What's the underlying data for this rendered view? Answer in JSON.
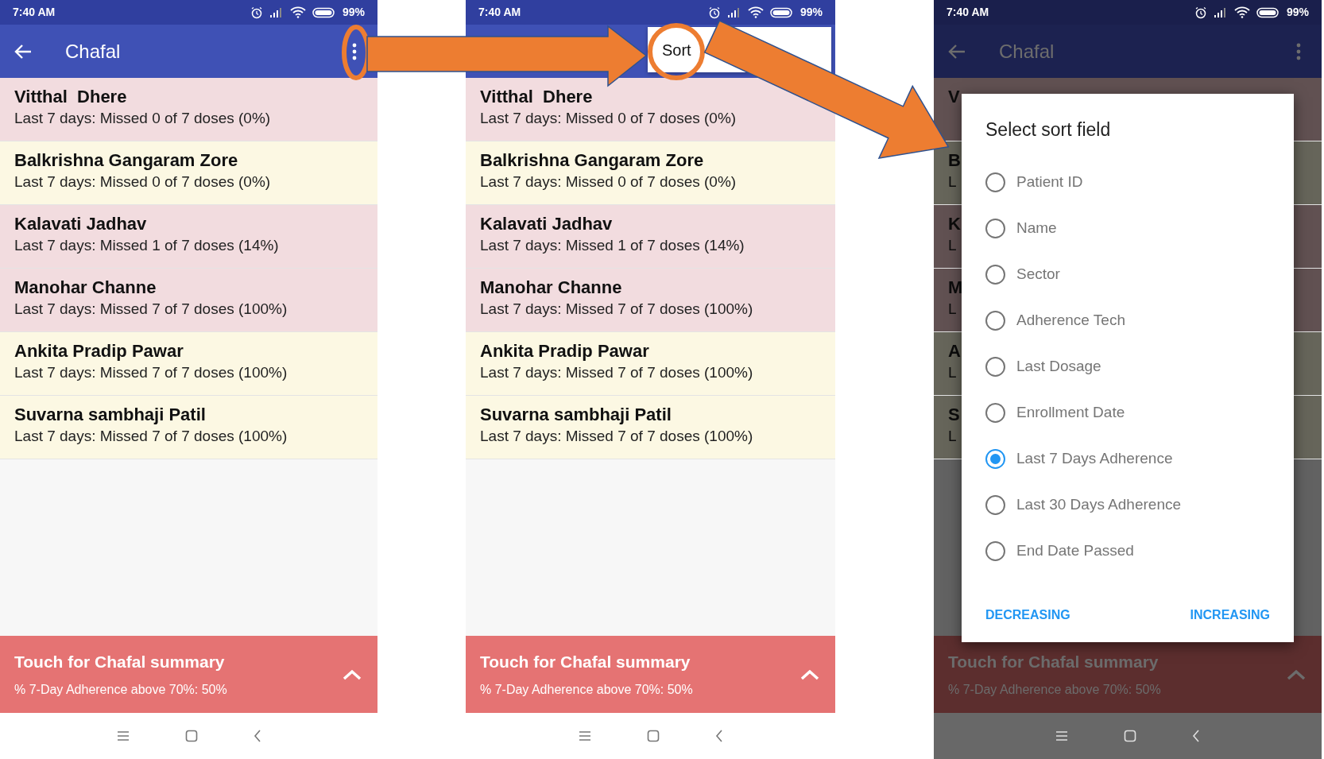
{
  "screens": [
    {
      "kind": "list",
      "dimmed": false,
      "status_bar": {
        "time": "7:40 AM",
        "battery": "99%"
      },
      "app_bar": {
        "title": "Chafal"
      },
      "patients": [
        {
          "name": "Vitthal  Dhere",
          "detail": "Last 7 days: Missed 0 of 7 doses (0%)",
          "color": "#f2dcdf"
        },
        {
          "name": "Balkrishna Gangaram Zore",
          "detail": "Last 7 days: Missed 0 of 7 doses (0%)",
          "color": "#fcf8e3"
        },
        {
          "name": "Kalavati Jadhav",
          "detail": "Last 7 days: Missed 1 of 7 doses (14%)",
          "color": "#f2dcdf"
        },
        {
          "name": "Manohar Channe",
          "detail": "Last 7 days: Missed 7 of 7 doses (100%)",
          "color": "#f2dcdf"
        },
        {
          "name": "Ankita Pradip Pawar",
          "detail": "Last 7 days: Missed 7 of 7 doses (100%)",
          "color": "#fcf8e3"
        },
        {
          "name": "Suvarna sambhaji Patil",
          "detail": "Last 7 days: Missed 7 of 7 doses (100%)",
          "color": "#fcf8e3"
        }
      ],
      "summary": {
        "title": "Touch for Chafal summary",
        "detail": "% 7-Day Adherence above 70%: 50%"
      }
    },
    {
      "kind": "menu",
      "dimmed": false,
      "status_bar": {
        "time": "7:40 AM",
        "battery": "99%"
      },
      "menu": {
        "items": [
          "Sort"
        ]
      },
      "patients": [
        {
          "name": "Vitthal  Dhere",
          "detail": "Last 7 days: Missed 0 of 7 doses (0%)",
          "color": "#f2dcdf"
        },
        {
          "name": "Balkrishna Gangaram Zore",
          "detail": "Last 7 days: Missed 0 of 7 doses (0%)",
          "color": "#fcf8e3"
        },
        {
          "name": "Kalavati Jadhav",
          "detail": "Last 7 days: Missed 1 of 7 doses (14%)",
          "color": "#f2dcdf"
        },
        {
          "name": "Manohar Channe",
          "detail": "Last 7 days: Missed 7 of 7 doses (100%)",
          "color": "#f2dcdf"
        },
        {
          "name": "Ankita Pradip Pawar",
          "detail": "Last 7 days: Missed 7 of 7 doses (100%)",
          "color": "#fcf8e3"
        },
        {
          "name": "Suvarna sambhaji Patil",
          "detail": "Last 7 days: Missed 7 of 7 doses (100%)",
          "color": "#fcf8e3"
        }
      ],
      "summary": {
        "title": "Touch for Chafal summary",
        "detail": "% 7-Day Adherence above 70%: 50%"
      }
    },
    {
      "kind": "dialog",
      "dimmed": true,
      "status_bar": {
        "time": "7:40 AM",
        "battery": "99%"
      },
      "app_bar": {
        "title": "Chafal"
      },
      "patients": [
        {
          "name": "V",
          "color": "#615152"
        },
        {
          "name": "B",
          "detail": "L",
          "color": "#66655a"
        },
        {
          "name": "K",
          "detail": "L",
          "color": "#615152"
        },
        {
          "name": "M",
          "detail": "L",
          "color": "#615152"
        },
        {
          "name": "A",
          "detail": "L",
          "color": "#66655a"
        },
        {
          "name": "S",
          "detail": "L",
          "color": "#66655a"
        }
      ],
      "summary": {
        "title": "Touch for Chafal summary",
        "detail": "% 7-Day Adherence above 70%: 50%"
      },
      "dialog": {
        "title": "Select sort field",
        "options": [
          {
            "label": "Patient ID",
            "selected": false
          },
          {
            "label": "Name",
            "selected": false
          },
          {
            "label": "Sector",
            "selected": false
          },
          {
            "label": "Adherence Tech",
            "selected": false
          },
          {
            "label": "Last Dosage",
            "selected": false
          },
          {
            "label": "Enrollment Date",
            "selected": false
          },
          {
            "label": "Last 7 Days Adherence",
            "selected": true
          },
          {
            "label": "Last 30 Days Adherence",
            "selected": false
          },
          {
            "label": "End Date Passed",
            "selected": false
          }
        ],
        "buttons": [
          "DECREASING",
          "INCREASING"
        ]
      }
    }
  ]
}
